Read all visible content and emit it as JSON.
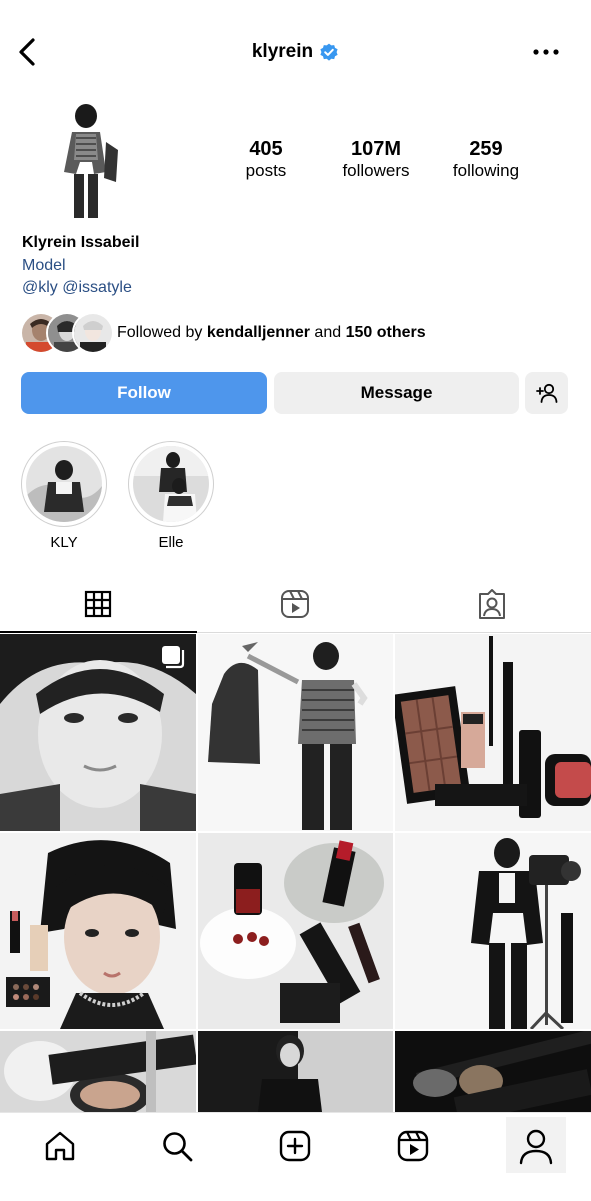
{
  "header": {
    "username": "klyrein",
    "icons": {
      "back": "chevron-left-icon",
      "verified": "verified-badge-icon",
      "more": "more-horizontal-icon"
    }
  },
  "stats": {
    "posts": {
      "value": "405",
      "label": "posts"
    },
    "followers": {
      "value": "107M",
      "label": "followers"
    },
    "following": {
      "value": "259",
      "label": "following"
    }
  },
  "bio": {
    "name": "Klyrein Issabeil",
    "category": "Model",
    "handles": "@kly @issatyle"
  },
  "followed_by": {
    "prefix": "Followed by ",
    "user": "kendalljenner",
    "middle": " and ",
    "others": "150 others"
  },
  "actions": {
    "follow": "Follow",
    "message": "Message",
    "add_user_icon": "add-user-icon"
  },
  "highlights": [
    {
      "label": "KLY"
    },
    {
      "label": "Elle"
    }
  ],
  "tabs": [
    {
      "icon": "grid-icon",
      "active": true
    },
    {
      "icon": "reels-icon",
      "active": false
    },
    {
      "icon": "tagged-icon",
      "active": false
    }
  ],
  "grid_posts": [
    {
      "description": "close-up black and white portrait",
      "multi": true
    },
    {
      "description": "model holding jacket"
    },
    {
      "description": "makeup palette and brushes"
    },
    {
      "description": "portrait with cosmetics"
    },
    {
      "description": "red lipstick and nail polish"
    },
    {
      "description": "model with camera"
    },
    {
      "description": "compact powder"
    },
    {
      "description": "model in black outfit"
    },
    {
      "description": "makeup brushes on black"
    }
  ],
  "bottom_nav": [
    {
      "icon": "home-icon"
    },
    {
      "icon": "search-icon"
    },
    {
      "icon": "create-post-icon"
    },
    {
      "icon": "reels-icon"
    },
    {
      "icon": "profile-icon",
      "active": true
    }
  ],
  "colors": {
    "follow_button": "#4e96ec",
    "secondary_button": "#efefef",
    "link_text": "#2b4f84",
    "verified": "#3897f0"
  }
}
